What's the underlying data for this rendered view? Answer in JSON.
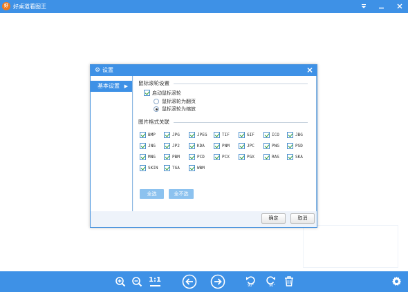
{
  "window": {
    "title": "好桌道看图王",
    "logo_text": "好"
  },
  "dialog": {
    "title": "设置",
    "nav": {
      "active_label": "基本设置"
    },
    "wheel_section": {
      "title": "鼠标滚轮设置",
      "enable_label": "启动鼠标滚轮",
      "options": [
        {
          "label": "鼠标滚轮为翻页",
          "selected": false
        },
        {
          "label": "鼠标滚轮为缩放",
          "selected": true
        }
      ]
    },
    "format_section": {
      "title": "图片格式关联",
      "formats": [
        "BMP",
        "JPG",
        "JPEG",
        "TIF",
        "GIF",
        "ICO",
        "JBG",
        "JNG",
        "JP2",
        "KDA",
        "PNM",
        "JPC",
        "PNG",
        "PSD",
        "MNG",
        "PBM",
        "PCD",
        "PCX",
        "PGX",
        "RAS",
        "SKA",
        "SKIN",
        "TGA",
        "WBM"
      ]
    },
    "select_all_label": "全选",
    "select_none_label": "全不选",
    "ok_label": "确定",
    "cancel_label": "取消"
  },
  "toolbar": {
    "actual_size_label": "1:1",
    "rotate_left_label": "90°",
    "rotate_right_label": "90°",
    "icons": [
      "zoom-in-icon",
      "zoom-out-icon",
      "actual-size-icon",
      "previous-icon",
      "next-icon",
      "rotate-left-icon",
      "rotate-right-icon",
      "delete-icon",
      "settings-icon"
    ]
  },
  "colors": {
    "accent": "#3e91e6",
    "checkmark": "#2a9a3a",
    "light_button": "#8cc2ef"
  }
}
